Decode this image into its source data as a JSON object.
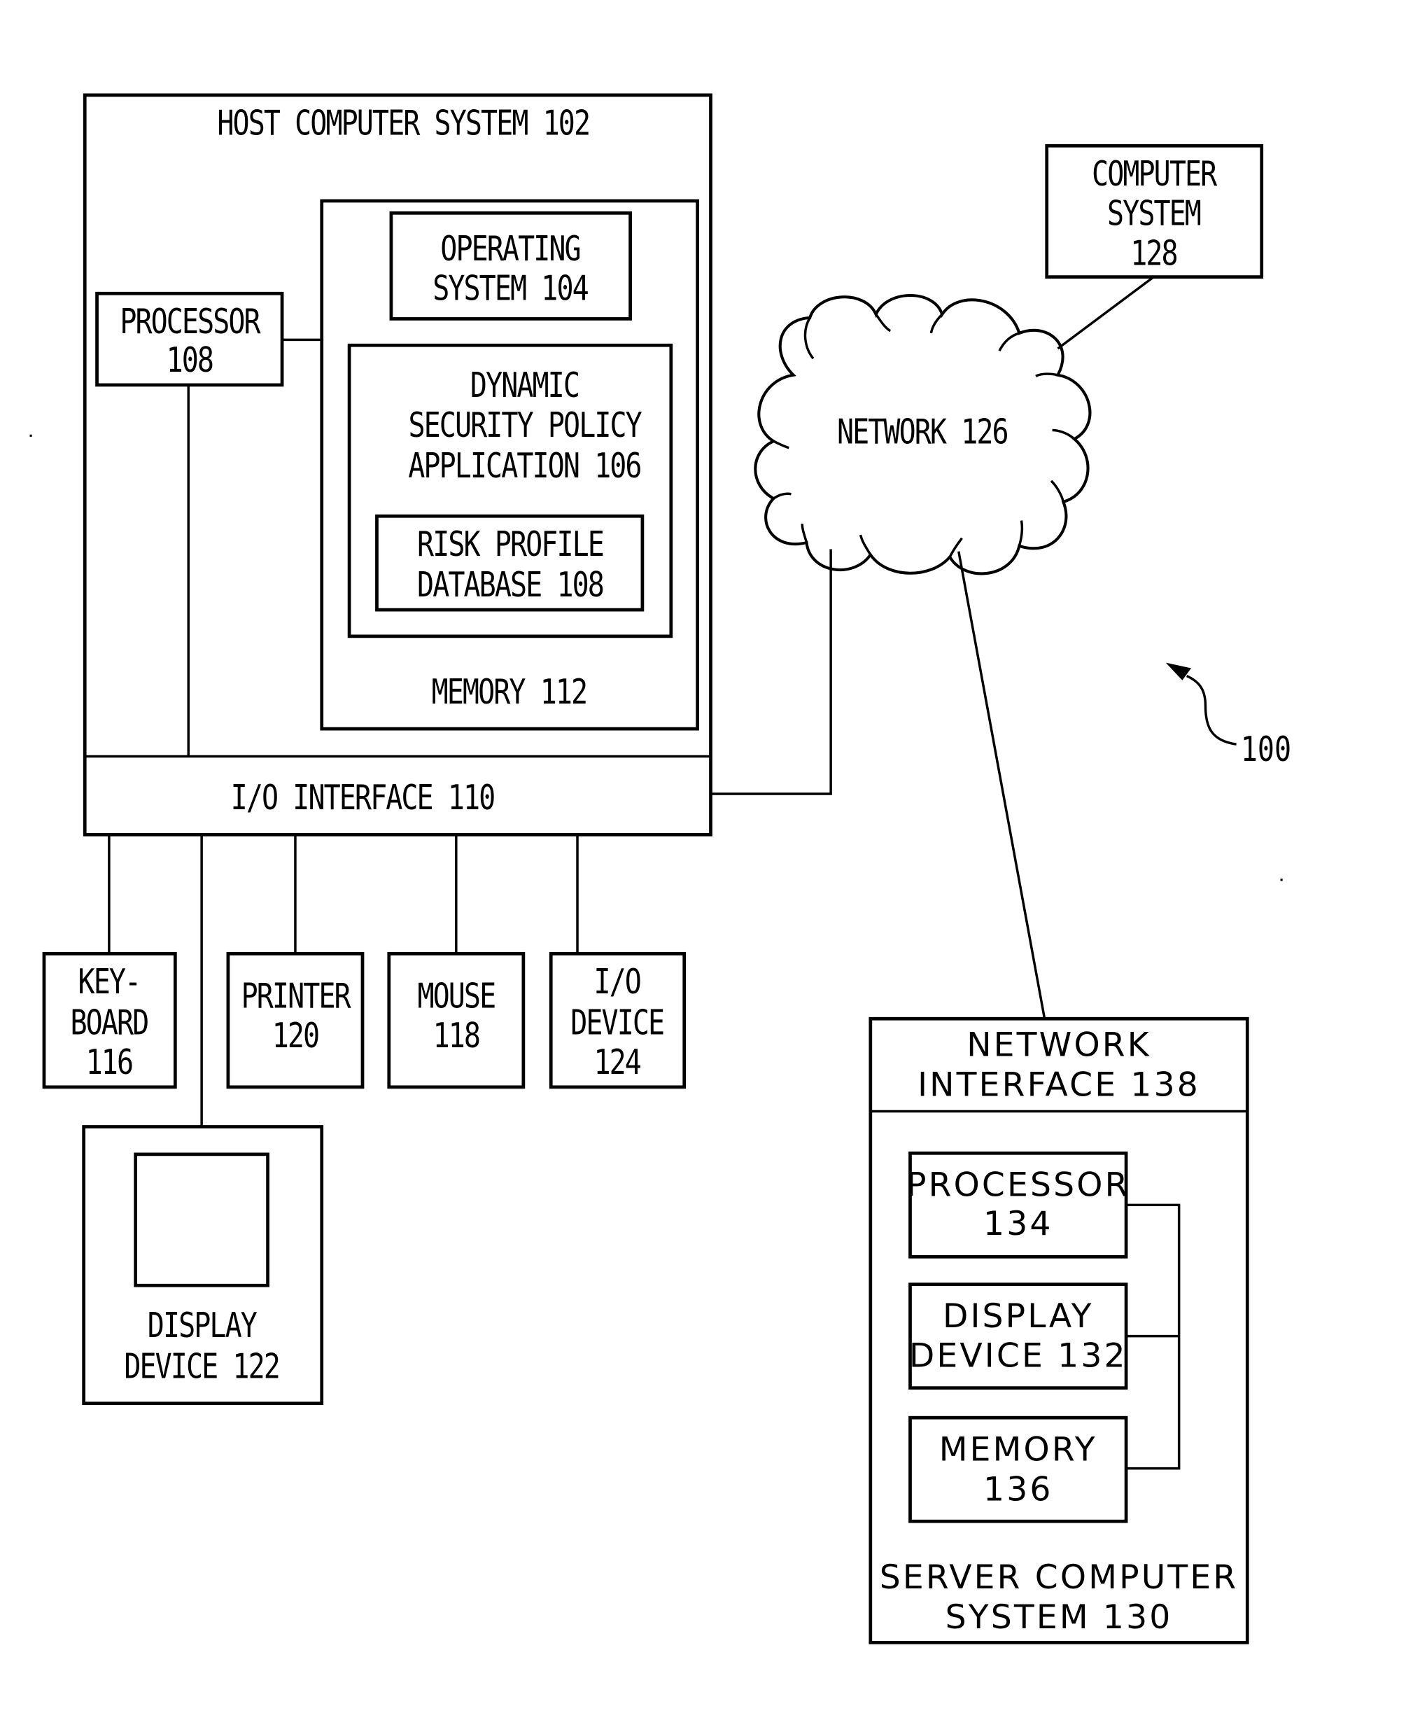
{
  "figure_ref": "100",
  "host": {
    "title": "HOST COMPUTER SYSTEM 102",
    "processor": [
      "PROCESSOR",
      "108"
    ],
    "operating_system": [
      "OPERATING",
      "SYSTEM 104"
    ],
    "application": [
      "DYNAMIC",
      "SECURITY POLICY",
      "APPLICATION 106"
    ],
    "database": [
      "RISK PROFILE",
      "DATABASE 108"
    ],
    "memory": "MEMORY 112",
    "io_interface": "I/O INTERFACE 110"
  },
  "peripherals": {
    "keyboard": [
      "KEY-",
      "BOARD",
      "116"
    ],
    "printer": [
      "PRINTER",
      "120"
    ],
    "mouse": [
      "MOUSE",
      "118"
    ],
    "io_device": [
      "I/O",
      "DEVICE",
      "124"
    ],
    "display": [
      "DISPLAY",
      "DEVICE 122"
    ]
  },
  "network": {
    "label": "NETWORK 126"
  },
  "computer_system": [
    "COMPUTER",
    "SYSTEM",
    "128"
  ],
  "server": {
    "network_interface": [
      "NETWORK",
      "INTERFACE 138"
    ],
    "processor": [
      "PROCESSOR",
      "134"
    ],
    "display": [
      "DISPLAY",
      "DEVICE 132"
    ],
    "memory": [
      "MEMORY",
      "136"
    ],
    "title": [
      "SERVER COMPUTER",
      "SYSTEM 130"
    ]
  }
}
